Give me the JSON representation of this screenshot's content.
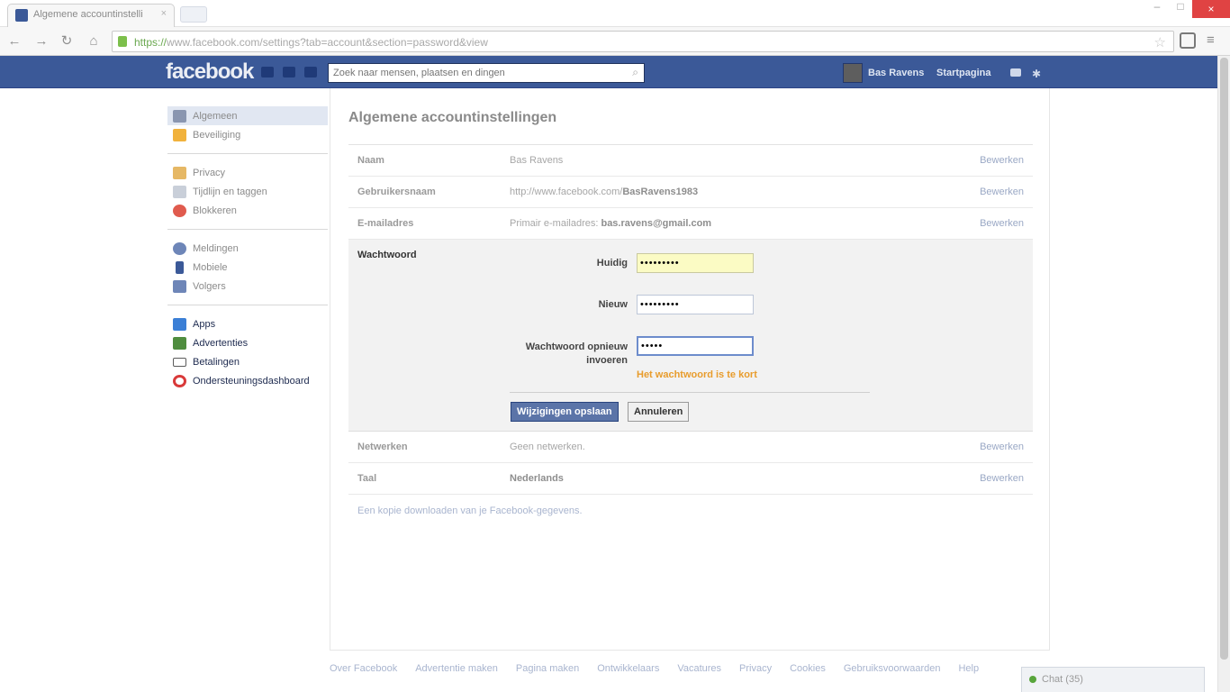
{
  "browser": {
    "tab_title": "Algemene accountinstelli",
    "tab_close": "×",
    "url_scheme": "https://",
    "url_rest": "www.facebook.com/settings?tab=account&section=password&view",
    "nav": {
      "back": "←",
      "forward": "→",
      "reload": "↻",
      "home": "⌂"
    },
    "star": "☆",
    "menu": "≡",
    "win": {
      "min": "–",
      "max": "□",
      "close": "×"
    }
  },
  "fb_header": {
    "logo": "facebook",
    "search_placeholder": "Zoek naar mensen, plaatsen en dingen",
    "search_icon": "⌕",
    "user_name": "Bas Ravens",
    "home_link": "Startpagina",
    "gear": "✱"
  },
  "left_nav": {
    "group1": [
      {
        "label": "Algemeen",
        "icon": "wrench-icon",
        "color": "#8a96b0"
      },
      {
        "label": "Beveiliging",
        "icon": "shield-icon",
        "color": "#f1b23c"
      }
    ],
    "group2": [
      {
        "label": "Privacy",
        "icon": "lock-icon",
        "color": "#e6b865"
      },
      {
        "label": "Tijdlijn en taggen",
        "icon": "calendar-icon",
        "color": "#c9cfd9"
      },
      {
        "label": "Blokkeren",
        "icon": "block-icon",
        "color": "#e05b4e"
      }
    ],
    "group3": [
      {
        "label": "Meldingen",
        "icon": "globe-icon",
        "color": "#6e86b8"
      },
      {
        "label": "Mobiele",
        "icon": "mobile-icon",
        "color": "#3b5998"
      },
      {
        "label": "Volgers",
        "icon": "rss-icon",
        "color": "#6e86b8"
      }
    ],
    "group4": [
      {
        "label": "Apps",
        "icon": "apps-icon",
        "color": "#3b7fd6"
      },
      {
        "label": "Advertenties",
        "icon": "ads-icon",
        "color": "#4f8d3f"
      },
      {
        "label": "Betalingen",
        "icon": "credit-card-icon",
        "color": "#5b5b5b"
      },
      {
        "label": "Ondersteuningsdashboard",
        "icon": "lifebuoy-icon",
        "color": "#d93a3a"
      }
    ]
  },
  "main": {
    "title": "Algemene accountinstellingen",
    "rows_top": [
      {
        "label": "Naam",
        "value": "Bas Ravens",
        "value_bold": "",
        "edit": "Bewerken"
      },
      {
        "label": "Gebruikersnaam",
        "value": "http://www.facebook.com/",
        "value_bold": "BasRavens1983",
        "edit": "Bewerken"
      },
      {
        "label": "E-mailadres",
        "value": "Primair e-mailadres: ",
        "value_bold": "bas.ravens@gmail.com",
        "edit": "Bewerken"
      }
    ],
    "password": {
      "section_label": "Wachtwoord",
      "current_label": "Huidig",
      "current_value": "•••••••••",
      "new_label": "Nieuw",
      "new_value": "•••••••••",
      "repeat_label": "Wachtwoord opnieuw invoeren",
      "repeat_value": "•••••",
      "error": "Het wachtwoord is te kort",
      "save": "Wijzigingen opslaan",
      "cancel": "Annuleren"
    },
    "rows_bottom": [
      {
        "label": "Netwerken",
        "value": "Geen netwerken.",
        "value_bold": "",
        "edit": "Bewerken"
      },
      {
        "label": "Taal",
        "value": "",
        "value_bold": "Nederlands",
        "edit": "Bewerken"
      }
    ],
    "download_link": "Een kopie downloaden van je Facebook-gegevens."
  },
  "footer": [
    "Over Facebook",
    "Advertentie maken",
    "Pagina maken",
    "Ontwikkelaars",
    "Vacatures",
    "Privacy",
    "Cookies",
    "Gebruiksvoorwaarden",
    "Help"
  ],
  "chat": {
    "label": "Chat (35)"
  }
}
